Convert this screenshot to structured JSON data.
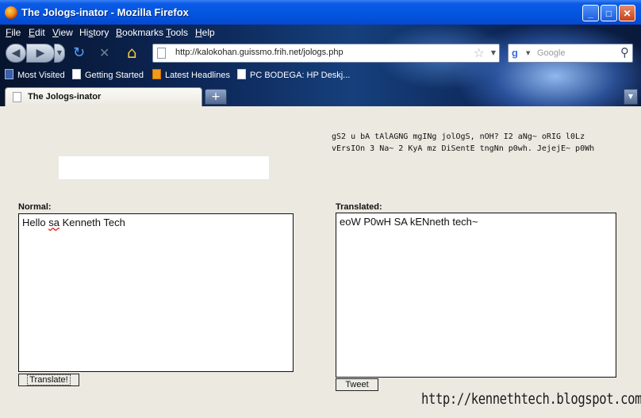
{
  "window": {
    "title": "The Jologs-inator - Mozilla Firefox",
    "controls": {
      "minimize": "_",
      "maximize": "□",
      "close": "✕"
    }
  },
  "menubar": {
    "items": [
      {
        "label": "File",
        "accel": "F",
        "rest": "ile"
      },
      {
        "label": "Edit",
        "accel": "E",
        "rest": "dit"
      },
      {
        "label": "View",
        "accel": "V",
        "rest": "iew"
      },
      {
        "label": "History",
        "accel": "",
        "pre": "Hi",
        "mid": "s",
        "post": "tory"
      },
      {
        "label": "Bookmarks",
        "accel": "B",
        "rest": "ookmarks"
      },
      {
        "label": "Tools",
        "accel": "T",
        "rest": "ools"
      },
      {
        "label": "Help",
        "accel": "H",
        "rest": "elp"
      }
    ]
  },
  "navigation": {
    "url": "http://kalokohan.guissmo.frih.net/jologs.php",
    "search_engine": "Google",
    "search_placeholder": "Google"
  },
  "bookmarks": [
    {
      "label": "Most Visited",
      "icon": "most-visited-icon"
    },
    {
      "label": "Getting Started",
      "icon": "page-icon"
    },
    {
      "label": "Latest Headlines",
      "icon": "rss-icon"
    },
    {
      "label": "PC BODEGA: HP Deskj...",
      "icon": "page-icon"
    }
  ],
  "tabs": [
    {
      "label": "The Jologs-inator",
      "active": true
    }
  ],
  "page": {
    "scrolling_text_line1": "gS2 u bA tAlAGNG mgINg jolOgS, nOH? I2 aNg~ oRIG l0Lz",
    "scrolling_text_line2": "vErsIOn 3 Na~ 2 KyA mz DiSentE tngNn p0wh. JejejE~ p0Wh",
    "normal_label": "Normal:",
    "normal_text_pre": "Hello ",
    "normal_text_misspelled": "sa",
    "normal_text_post": " Kenneth Tech",
    "translate_button": "Translate!",
    "translated_label": "Translated:",
    "translated_text": "eoW P0wH SA kENneth tech~",
    "tweet_button": "Tweet",
    "watermark": "http://kennethtech.blogspot.com/"
  }
}
